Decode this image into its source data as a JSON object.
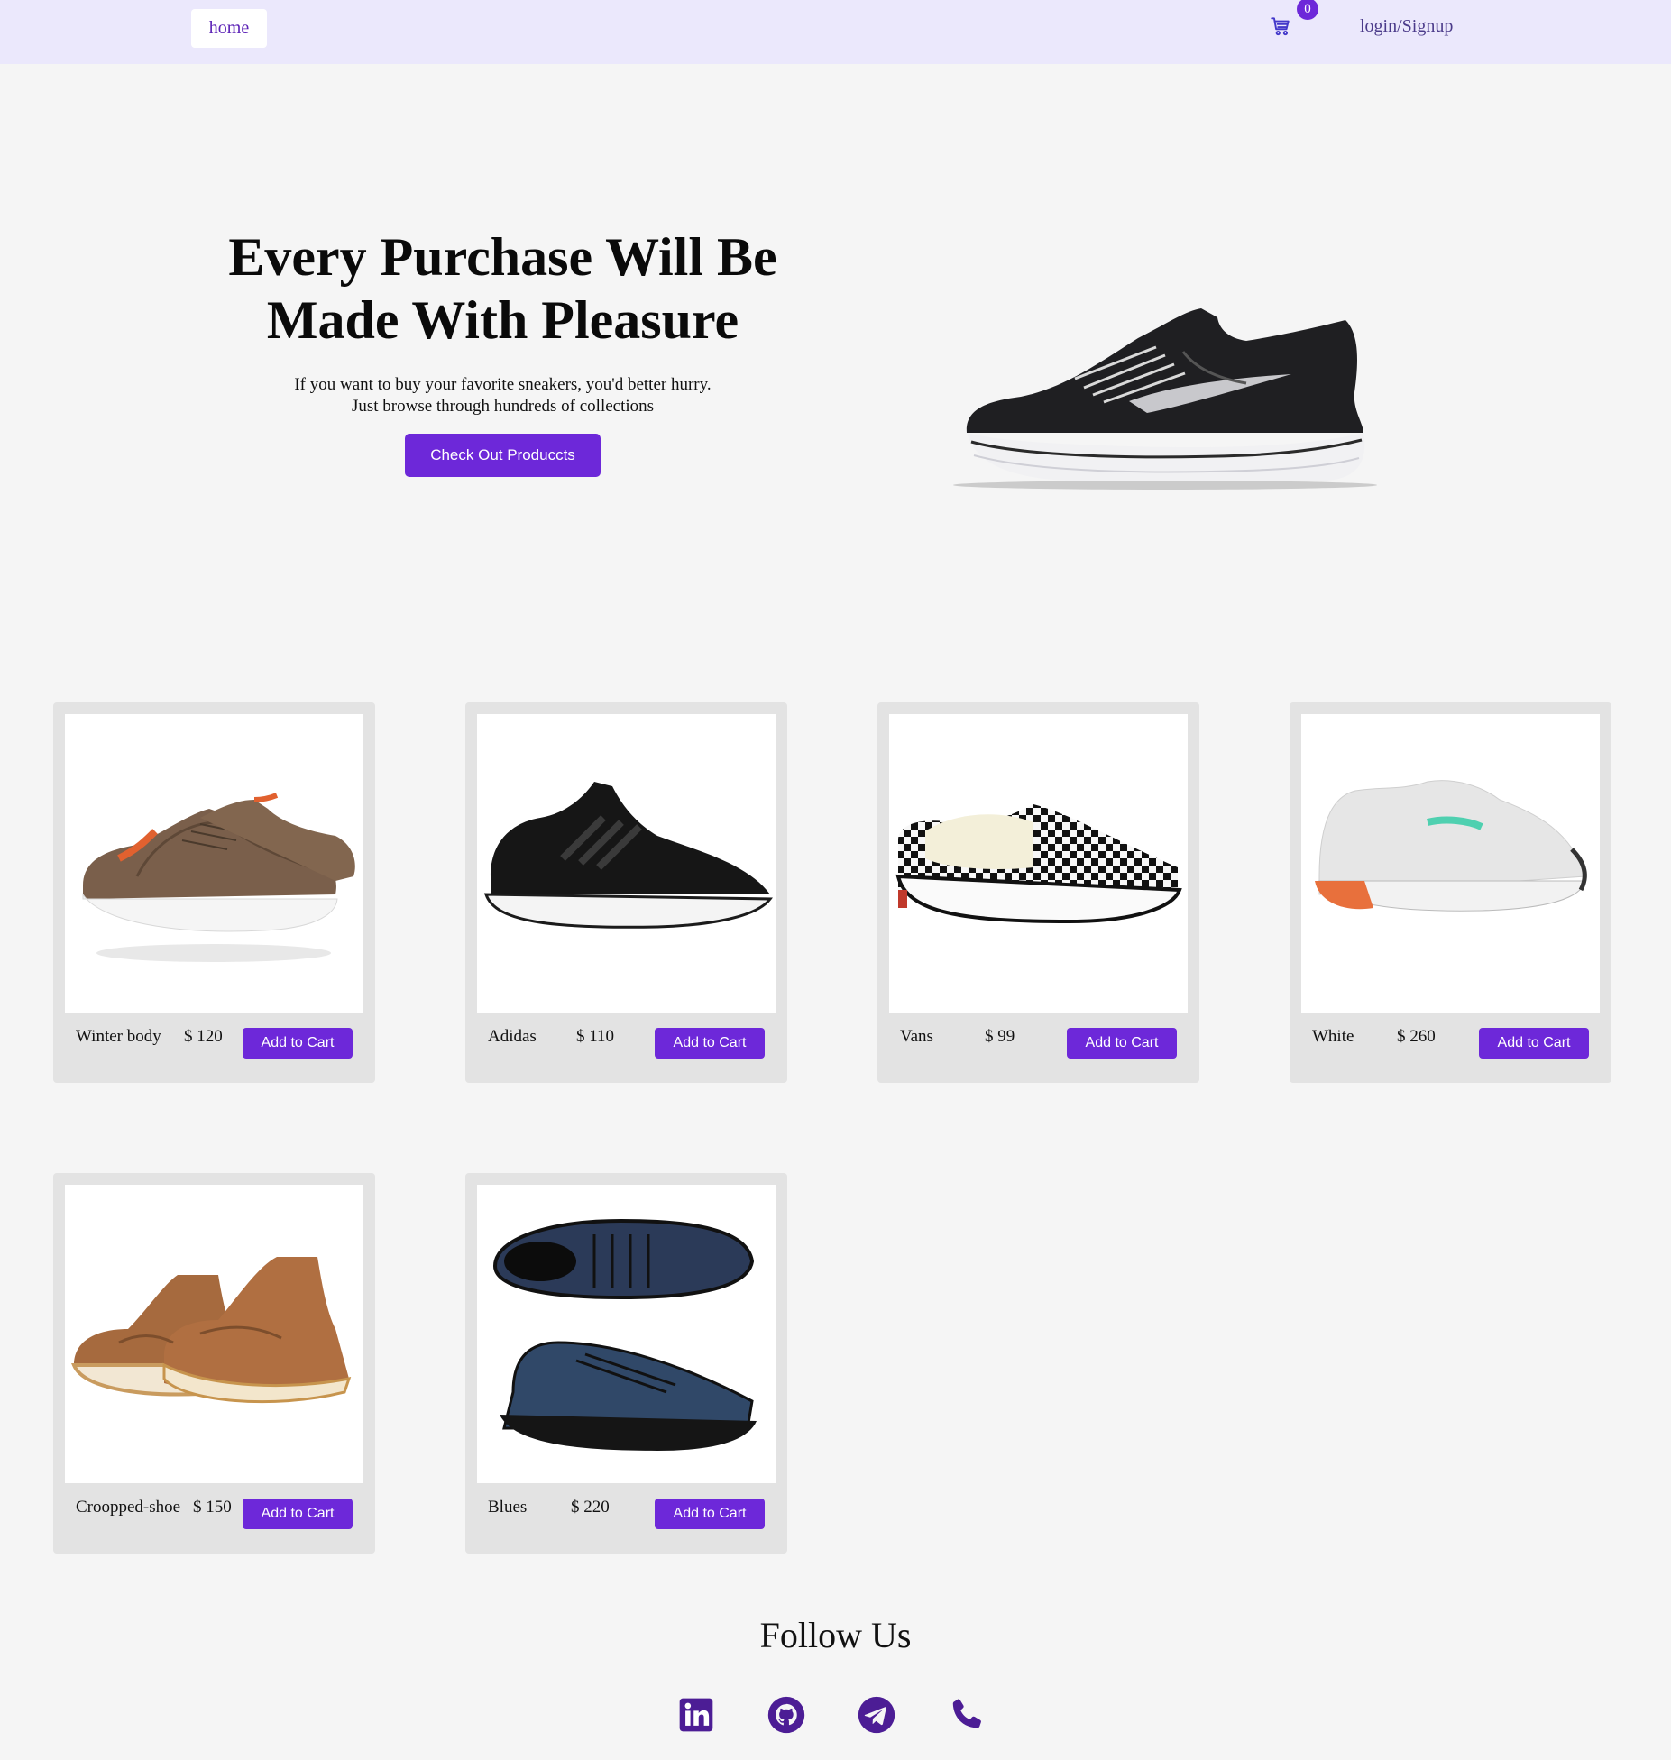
{
  "nav": {
    "home_label": "home",
    "cart_count": "0",
    "login_label": "login/Signup"
  },
  "hero": {
    "title_line1": "Every Purchase Will Be",
    "title_line2": "Made With Pleasure",
    "subtitle_line1": "If you want to buy your favorite sneakers, you'd better hurry.",
    "subtitle_line2": "Just browse through hundreds of collections",
    "cta_label": "Check Out Produccts"
  },
  "products": [
    {
      "name": "Winter body",
      "price": "$ 120",
      "button": "Add to Cart"
    },
    {
      "name": "Adidas",
      "price": "$ 110",
      "button": "Add to Cart"
    },
    {
      "name": "Vans",
      "price": "$ 99",
      "button": "Add to Cart"
    },
    {
      "name": "White",
      "price": "$ 260",
      "button": "Add to Cart"
    },
    {
      "name": "Croopped-shoe",
      "price": "$ 150",
      "button": "Add to Cart"
    },
    {
      "name": "Blues",
      "price": "$ 220",
      "button": "Add to Cart"
    }
  ],
  "footer": {
    "follow_title": "Follow Us",
    "social_icons": [
      "linkedin-icon",
      "github-icon",
      "telegram-icon",
      "phone-icon"
    ]
  },
  "colors": {
    "accent": "#6d28d9",
    "nav_bg": "#ebe8fc",
    "page_bg": "#f5f5f5",
    "card_bg": "#e3e3e3",
    "footer_icon": "#4c1d95"
  }
}
